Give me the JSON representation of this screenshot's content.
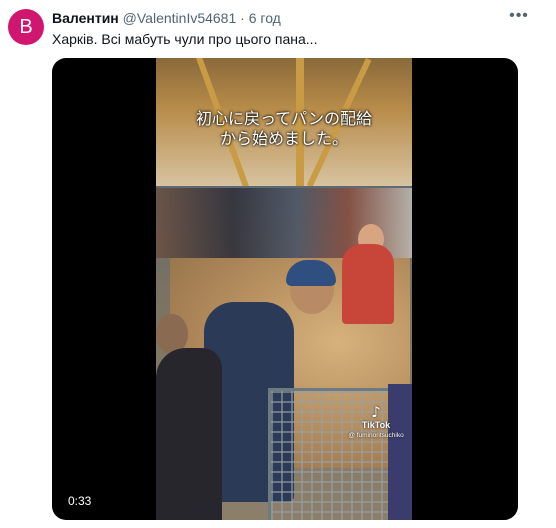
{
  "tweet": {
    "avatar_letter": "B",
    "avatar_color": "#d1166f",
    "display_name": "Валентин",
    "handle": "@ValentinIv54681",
    "separator": "·",
    "time": "6 год",
    "more_icon": "more-horizontal-icon",
    "text": "Харків. Всі мабуть чули про цього пана..."
  },
  "video": {
    "caption_line1": "初心に戻ってパンの配給",
    "caption_line2": "から始めました。",
    "watermark_brand": "TikTok",
    "watermark_user": "@ fuminoritsuchiko",
    "duration": "0:33"
  }
}
